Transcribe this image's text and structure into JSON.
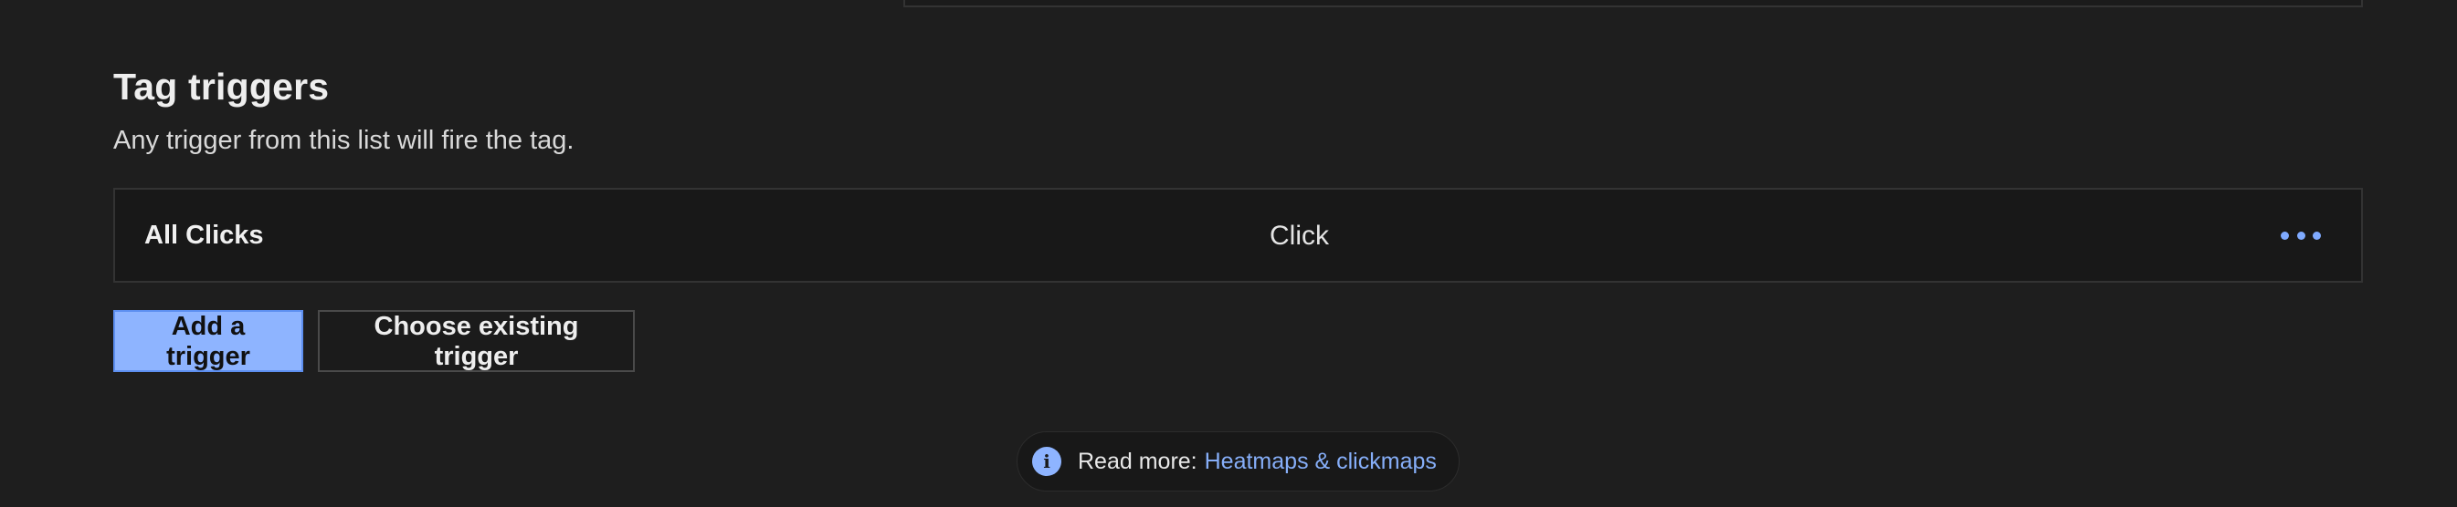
{
  "section": {
    "title": "Tag triggers",
    "description": "Any trigger from this list will fire the tag."
  },
  "triggers": [
    {
      "name": "All Clicks",
      "type": "Click"
    }
  ],
  "actions": {
    "add_trigger_label": "Add a trigger",
    "choose_existing_label": "Choose existing trigger"
  },
  "read_more": {
    "icon": "info-icon",
    "label": "Read more:",
    "link_text": "Heatmaps & clickmaps"
  },
  "colors": {
    "background": "#1e1e1e",
    "accent": "#8eb4ff",
    "link": "#86aef8"
  }
}
